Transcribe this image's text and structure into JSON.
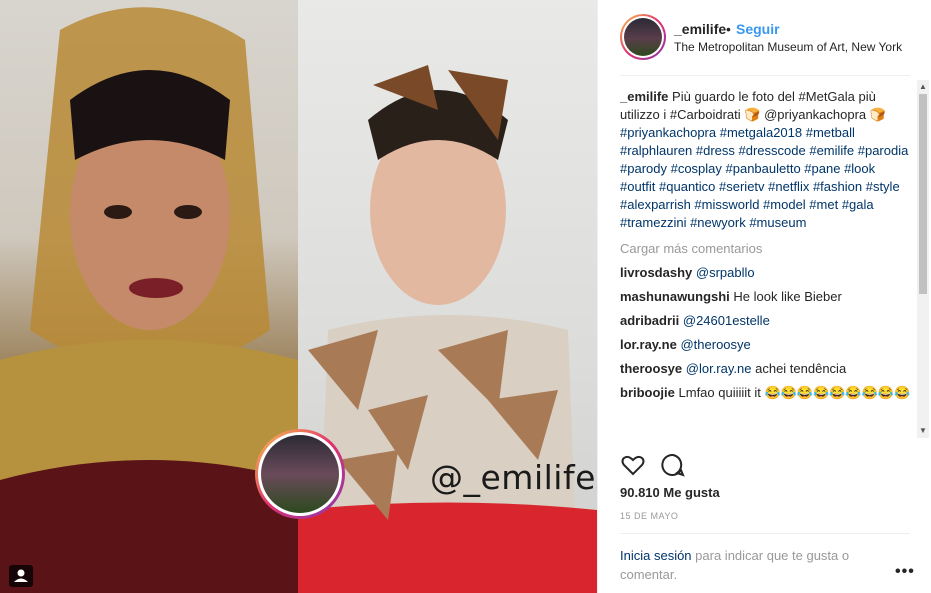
{
  "post": {
    "watermark": "@_emilife"
  },
  "header": {
    "username": "_emilife",
    "separator": "•",
    "follow_label": "Seguir",
    "location": "The Metropolitan Museum of Art, New York"
  },
  "caption": {
    "username": "_emilife",
    "text": "Più guardo le foto del #MetGala più utilizzo i #Carboidrati 🍞 @priyankachopra 🍞",
    "tags": "#priyankachopra #metgala2018 #metball #ralphlauren #dress #dresscode #emilife #parodia #parody #cosplay #panbauletto #pane #look #outfit #quantico #serietv #netflix #fashion #style #alexparrish #missworld #model #met #gala #tramezzini #newyork #museum"
  },
  "load_more": "Cargar más comentarios",
  "comments": [
    {
      "user": "livrosdashy",
      "mention": "@srpabllo",
      "text": ""
    },
    {
      "user": "mashunawungshi",
      "mention": "",
      "text": "He look like Bieber"
    },
    {
      "user": "adribadrii",
      "mention": "@24601estelle",
      "text": ""
    },
    {
      "user": "lor.ray.ne",
      "mention": "@theroosye",
      "text": ""
    },
    {
      "user": "theroosye",
      "mention": "@lor.ray.ne",
      "text": "achei tendência"
    },
    {
      "user": "briboojie",
      "mention": "",
      "text": "Lmfao quiiiiit it 😂😂😂😂😂😂😂😂😂"
    }
  ],
  "likes": "90.810 Me gusta",
  "date": "15 DE MAYO",
  "footer": {
    "login_link": "Inicia sesión",
    "login_text": "para indicar que te gusta o comentar.",
    "more": "•••"
  },
  "colors": {
    "accent": "#3897f0",
    "link": "#003569",
    "muted": "#999999"
  }
}
